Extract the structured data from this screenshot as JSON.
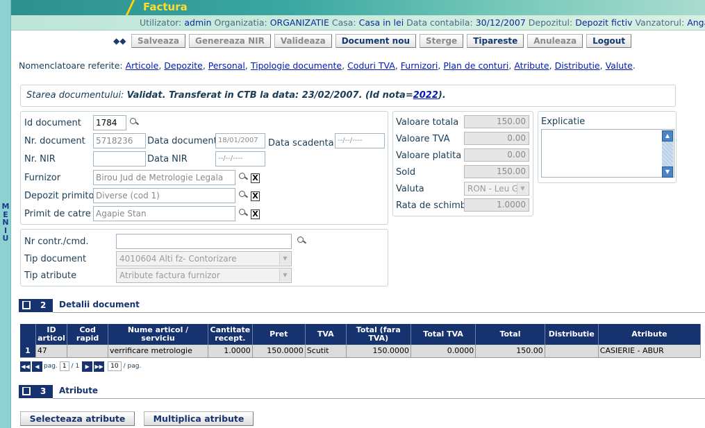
{
  "menu": {
    "letters": [
      "M",
      "E",
      "N",
      "I",
      "U"
    ]
  },
  "header": {
    "title": "Factura",
    "info": [
      {
        "label": "Utilizator:",
        "value": "admin"
      },
      {
        "label": "Organizatia:",
        "value": "ORGANIZATIE"
      },
      {
        "label": "Casa:",
        "value": "Casa in lei"
      },
      {
        "label": "Data contabila:",
        "value": "30/12/2007"
      },
      {
        "label": "Depozitul:",
        "value": "Depozit fictiv"
      },
      {
        "label": "Vanzatorul:",
        "value": "Anga"
      }
    ]
  },
  "toolbar": {
    "arrows": "◆◆",
    "salveaza": "Salveaza",
    "genereaza_nir": "Genereaza NIR",
    "valideaza": "Valideaza",
    "document_nou": "Document nou",
    "sterge": "Sterge",
    "tipareste": "Tipareste",
    "anuleaza": "Anuleaza",
    "logout": "Logout"
  },
  "nomenclatoare": {
    "label": "Nomenclatoare referite:",
    "links": [
      "Articole",
      "Depozite",
      "Personal",
      "Tipologie documente",
      "Coduri TVA",
      "Furnizori",
      "Plan de conturi",
      "Atribute",
      "Distributie",
      "Valute"
    ]
  },
  "state": {
    "prefix": "Starea documentului:",
    "text": "Validat. Transferat in CTB la data: 23/02/2007. (Id nota=",
    "nota": "2022",
    "suffix": ")."
  },
  "doc": {
    "id_label": "Id document",
    "id_value": "1784",
    "nr_label": "Nr. document",
    "nr_value": "5718236",
    "data_doc_label": "Data document",
    "data_doc_value": "18/01/2007",
    "data_scad_label": "Data scadenta",
    "data_scad_value": "--/--/----",
    "nir_label": "Nr. NIR",
    "nir_value": "",
    "data_nir_label": "Data NIR",
    "data_nir_value": "--/--/----",
    "furnizor_label": "Furnizor",
    "furnizor_value": "Birou Jud de Metrologie Legala",
    "depozit_label": "Depozit primitor",
    "depozit_value": "Diverse (cod 1)",
    "primit_label": "Primit de catre",
    "primit_value": "Agapie Stan",
    "x": "X"
  },
  "contract": {
    "nr_label": "Nr contr./cmd.",
    "nr_value": "",
    "tip_doc_label": "Tip document",
    "tip_doc_value": "4010604 Alti fz- Contorizare",
    "tip_attr_label": "Tip atribute",
    "tip_attr_value": "Atribute factura furnizor",
    "arrow": "▼"
  },
  "values": {
    "totala_label": "Valoare totala",
    "totala": "150.00",
    "tva_label": "Valoare TVA",
    "tva": "0.00",
    "platita_label": "Valoare platita",
    "platita": "0.00",
    "sold_label": "Sold",
    "sold": "150.00",
    "valuta_label": "Valuta",
    "valuta": "RON - Leu G",
    "rata_label": "Rata de schimb",
    "rata": "1.0000"
  },
  "explicatie": {
    "label": "Explicatie",
    "value": "",
    "up": "▲",
    "down": "▼"
  },
  "section2": {
    "num": "2",
    "title": "Detalii document"
  },
  "section3": {
    "num": "3",
    "title": "Atribute"
  },
  "grid": {
    "headers": [
      "",
      "ID articol",
      "Cod rapid",
      "Nume articol / serviciu",
      "Cantitate recept.",
      "Pret",
      "TVA",
      "Total (fara TVA)",
      "Total TVA",
      "Total",
      "Distributie",
      "Atribute"
    ],
    "rows": [
      [
        "1",
        "47",
        "",
        "verrificare metrologie",
        "1.0000",
        "150.0000",
        "Scutit",
        "150.0000",
        "0.0000",
        "150.00",
        "",
        "CASIERIE - ABUR"
      ]
    ]
  },
  "pager": {
    "first": "◀◀",
    "prev": "◀",
    "next": "▶",
    "last": "▶▶",
    "pag_label": "pag.",
    "page": "1",
    "of": "/ 1",
    "per_page": "10",
    "per_label": "/ pag."
  },
  "bottom": {
    "selecteaza": "Selecteaza atribute",
    "multiplica": "Multiplica atribute"
  }
}
